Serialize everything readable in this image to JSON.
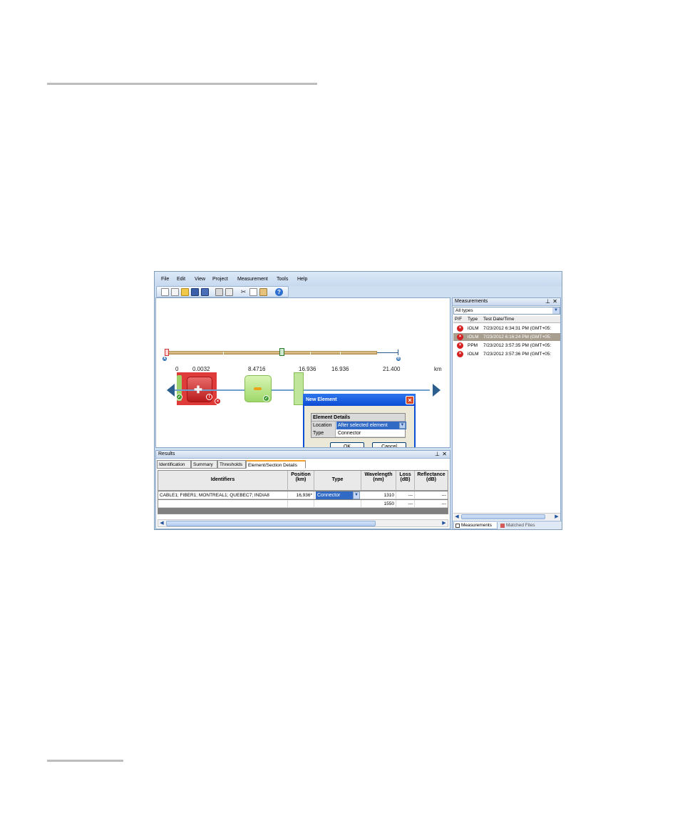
{
  "menu": [
    "File",
    "Edit",
    "View",
    "Project",
    "Measurement",
    "Tools",
    "Help"
  ],
  "toolbar_icons": [
    "new-icon",
    "new-from-template-icon",
    "open-icon",
    "save-icon",
    "save-all-icon",
    "print-icon",
    "print-preview-icon",
    "cut-icon",
    "copy-icon",
    "paste-icon",
    "help-icon"
  ],
  "link_view": {
    "marker_a": "A",
    "marker_b": "B",
    "distance_start": "0",
    "distance_1": "0.0032",
    "distance_2": "8.4716",
    "distance_3": "16.936",
    "distance_4": "16.936",
    "distance_5": "21.400",
    "unit": "km"
  },
  "dialog": {
    "title": "New Element",
    "section": "Element Details",
    "location_label": "Location",
    "location_value": "After selected element",
    "type_label": "Type",
    "type_value": "Connector",
    "ok_label": "OK",
    "cancel_label": "Cancel"
  },
  "results": {
    "panel_title": "Results",
    "tabs": [
      "Identification",
      "Summary",
      "Thresholds",
      "Element/Section Details"
    ],
    "columns": {
      "identifiers": "Identifiers",
      "position_1": "Position",
      "position_2": "(km)",
      "type": "Type",
      "wavelength_1": "Wavelength",
      "wavelength_2": "(nm)",
      "loss_1": "Loss",
      "loss_2": "(dB)",
      "reflectance_1": "Reflectance",
      "reflectance_2": "(dB)"
    },
    "rows": [
      {
        "identifiers": "CABLE1; FIBER1; MONTREAL1; QUEBEC7; INDIA8",
        "position": "16,936*",
        "type": "Connector",
        "wavelength": "1310",
        "loss": "---",
        "reflectance": "---"
      },
      {
        "identifiers": "",
        "position": "",
        "type": "",
        "wavelength": "1550",
        "loss": "---",
        "reflectance": "---"
      }
    ]
  },
  "measurements": {
    "panel_title": "Measurements",
    "filter": "All types",
    "columns": {
      "pf": "P/F",
      "type": "Type",
      "date": "Test Date/Time"
    },
    "rows": [
      {
        "type": "iOLM",
        "date": "7/23/2012 6:34:31 PM (GMT+05:",
        "selected": false
      },
      {
        "type": "iOLM",
        "date": "7/23/2012 6:16:24 PM (GMT+05:",
        "selected": true
      },
      {
        "type": "PPM",
        "date": "7/23/2012 3:57:35 PM (GMT+05:",
        "selected": false
      },
      {
        "type": "iOLM",
        "date": "7/23/2012 3:57:36 PM (GMT+05:",
        "selected": false
      }
    ],
    "bottom_tabs": [
      "Measurements",
      "Matched Files"
    ]
  },
  "colors": {
    "fail_red": "#d42020",
    "pass_green": "#3d9b2e",
    "accent_blue": "#316ac5",
    "dialog_titlebar": "#0b4bd4"
  }
}
